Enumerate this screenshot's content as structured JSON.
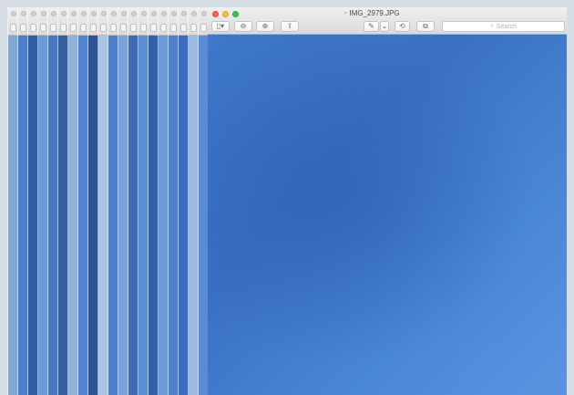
{
  "window": {
    "title": "IMG_2979.JPG",
    "document_icon": "image-file-icon"
  },
  "toolbar": {
    "sidebar_toggle": "▯▾",
    "zoom_out": "⊖",
    "zoom_in": "⊕",
    "share": "⇪",
    "markup": "✎",
    "markup_menu": "⌄",
    "rotate": "⟲",
    "toolbox": "⧉"
  },
  "search": {
    "placeholder": "Search",
    "icon": "magnifier-icon"
  },
  "ghost_windows": {
    "count": 20,
    "colors": [
      "#7fa7d6",
      "#4b7fcb",
      "#2e5ea8",
      "#6e9bd7",
      "#4778c4",
      "#355f9e",
      "#8fb2dd",
      "#5384cf",
      "#2d5296",
      "#a9c4e6",
      "#4e80cd",
      "#7aa3db",
      "#3d6ab3",
      "#5c8ed6",
      "#2f61ad",
      "#6d9ad8",
      "#4c7fce",
      "#3b6cbf",
      "#9bbbe3",
      "#5a8bd4"
    ]
  },
  "photo": {
    "description_color": "#3f78c8"
  }
}
